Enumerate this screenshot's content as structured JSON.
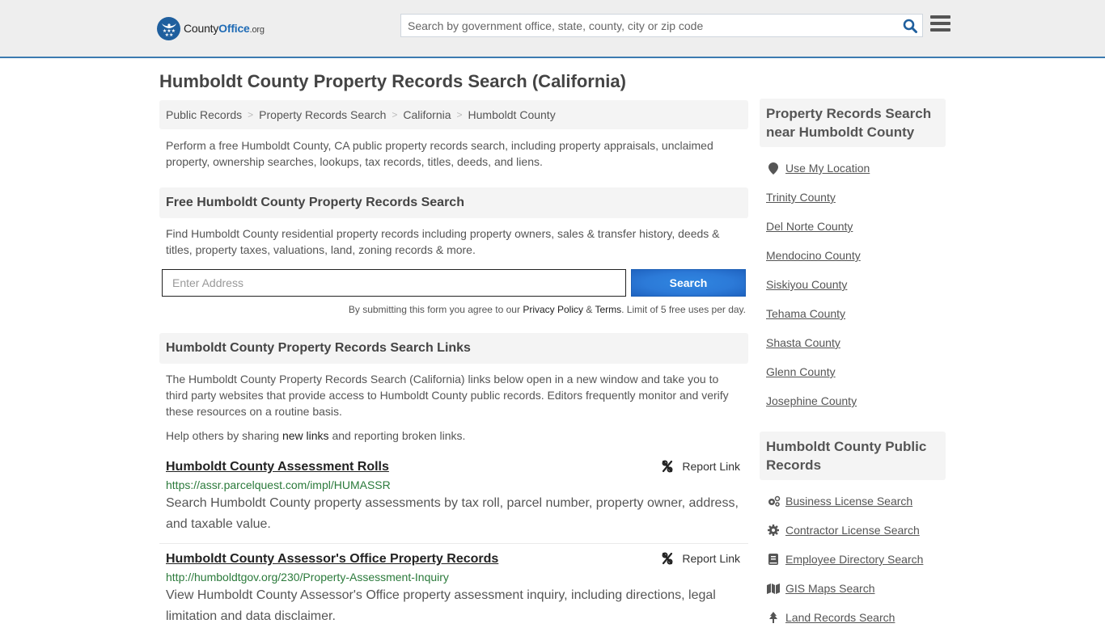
{
  "header": {
    "logo": {
      "county": "County",
      "office": "Office",
      "tld": ".org"
    },
    "search": {
      "placeholder": "Search by government office, state, county, city or zip code",
      "value": ""
    },
    "colors": {
      "brand": "#1f6bb5",
      "accent_line": "#3b7ab0"
    }
  },
  "page": {
    "title": "Humboldt County Property Records Search (California)"
  },
  "breadcrumb": [
    {
      "label": "Public Records"
    },
    {
      "label": "Property Records Search"
    },
    {
      "label": "California"
    },
    {
      "label": "Humboldt County"
    }
  ],
  "breadcrumb_separator": ">",
  "intro": "Perform a free Humboldt County, CA public property records search, including property appraisals, unclaimed property, ownership searches, lookups, tax records, titles, deeds, and liens.",
  "free_search": {
    "heading": "Free Humboldt County Property Records Search",
    "description": "Find Humboldt County residential property records including property owners, sales & transfer history, deeds & titles, property taxes, valuations, land, zoning records & more.",
    "address_placeholder": "Enter Address",
    "address_value": "",
    "button_label": "Search",
    "disclaimer_prefix": "By submitting this form you agree to our ",
    "privacy_label": "Privacy Policy",
    "amp": " & ",
    "terms_label": "Terms",
    "disclaimer_suffix": ". Limit of 5 free uses per day."
  },
  "links_section": {
    "heading": "Humboldt County Property Records Search Links",
    "description": "The Humboldt County Property Records Search (California) links below open in a new window and take you to third party websites that provide access to Humboldt County public records. Editors frequently monitor and verify these resources on a routine basis.",
    "help_prefix": "Help others by sharing ",
    "help_link": "new links",
    "help_suffix": " and reporting broken links.",
    "report_label": "Report Link",
    "items": [
      {
        "title": "Humboldt County Assessment Rolls",
        "url": "https://assr.parcelquest.com/impl/HUMASSR",
        "description": "Search Humboldt County property assessments by tax roll, parcel number, property owner, address, and taxable value."
      },
      {
        "title": "Humboldt County Assessor's Office Property Records",
        "url": "http://humboldtgov.org/230/Property-Assessment-Inquiry",
        "description": "View Humboldt County Assessor's Office property assessment inquiry, including directions, legal limitation and data disclaimer."
      }
    ]
  },
  "sidebar": {
    "nearby": {
      "heading": "Property Records Search near Humboldt County",
      "use_location": "Use My Location",
      "items": [
        "Trinity County",
        "Del Norte County",
        "Mendocino County",
        "Siskiyou County",
        "Tehama County",
        "Shasta County",
        "Glenn County",
        "Josephine County"
      ]
    },
    "public_records": {
      "heading": "Humboldt County Public Records",
      "items": [
        {
          "label": "Business License Search",
          "icon": "gears-icon"
        },
        {
          "label": "Contractor License Search",
          "icon": "gear-icon"
        },
        {
          "label": "Employee Directory Search",
          "icon": "book-icon"
        },
        {
          "label": "GIS Maps Search",
          "icon": "map-icon"
        },
        {
          "label": "Land Records Search",
          "icon": "tree-icon"
        }
      ]
    }
  }
}
